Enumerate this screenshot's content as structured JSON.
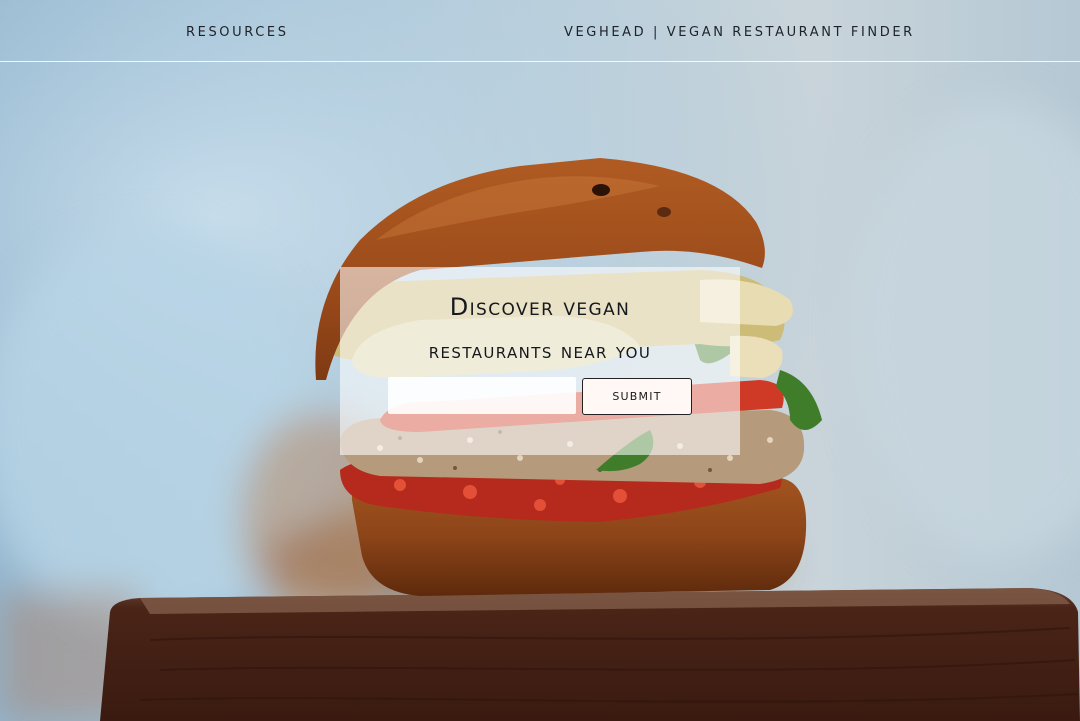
{
  "nav": {
    "resources_label": "RESOURCES",
    "brand_title": "VEGHEAD | VEGAN RESTAURANT FINDER"
  },
  "hero": {
    "image_icon": "burger-photo",
    "heading_line1": "Discover vegan",
    "heading_line2": "restaurants near you",
    "search_input_value": "",
    "search_input_placeholder": "",
    "submit_label": "SUBMIT"
  },
  "colors": {
    "nav_text": "#1e232a",
    "card_overlay": "#ffffff",
    "button_border": "#222222",
    "sky_blue": "#a9c6d9"
  }
}
